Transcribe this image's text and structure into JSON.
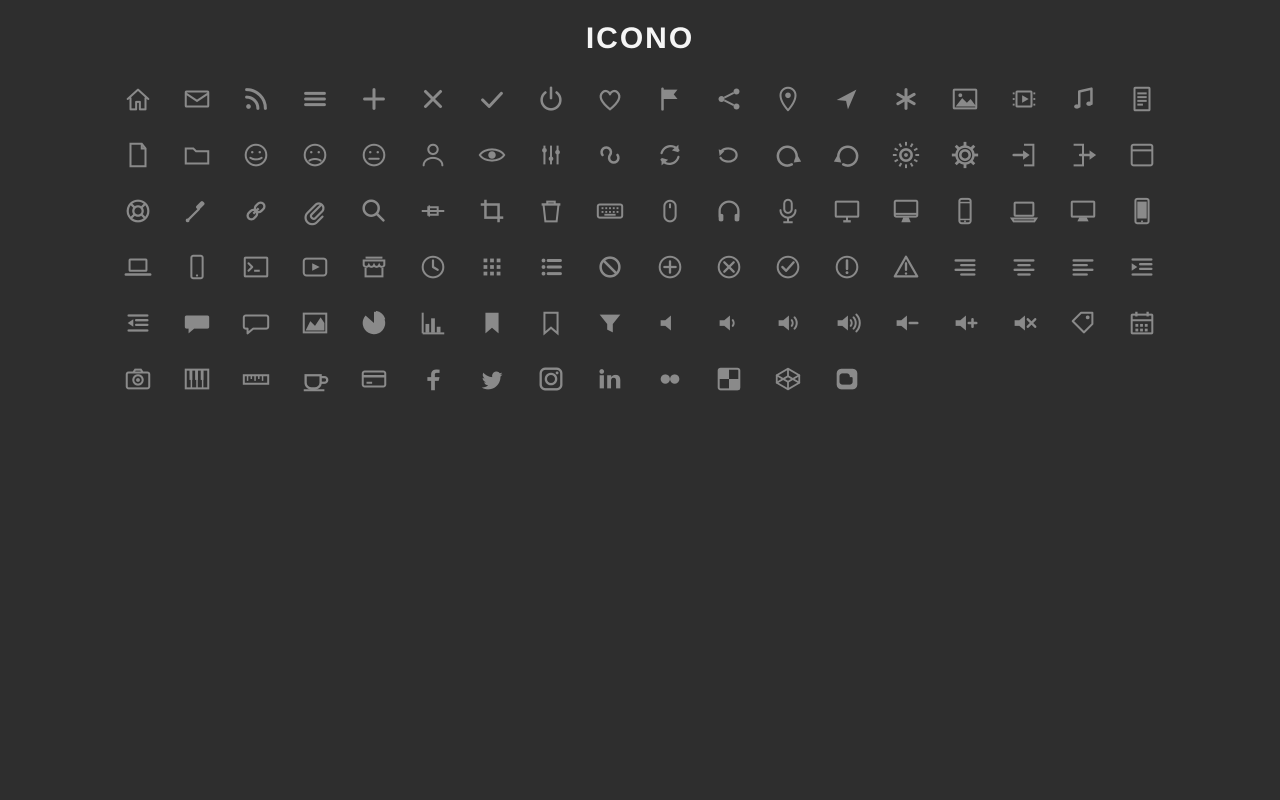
{
  "title": "ICONO",
  "colors": {
    "bg": "#2e2e2e",
    "icon": "#8a8a8a",
    "title": "#f5f5f5"
  },
  "icons": [
    "home",
    "mail",
    "rss",
    "hamburger",
    "plus",
    "cross",
    "check",
    "power",
    "heart",
    "flag",
    "share",
    "location-pin",
    "location-arrow",
    "asterisk",
    "image",
    "video",
    "music",
    "document",
    "file",
    "folder",
    "smile",
    "frown",
    "meh",
    "user",
    "eye",
    "sliders",
    "infinity",
    "sync",
    "loop",
    "undo",
    "redo",
    "sun",
    "gear",
    "sign-in",
    "sign-out",
    "browser",
    "life-ring",
    "dropper",
    "chain",
    "paperclip",
    "search",
    "text-align",
    "crop",
    "trash",
    "keyboard",
    "mouse",
    "headphones",
    "microphone",
    "display",
    "imac",
    "iphone",
    "macbook",
    "display-alt",
    "phone-device",
    "laptop",
    "phone-outline",
    "terminal",
    "youtube",
    "market",
    "clock",
    "tiles",
    "list",
    "forbidden",
    "plus-circle",
    "cross-circle",
    "check-circle",
    "exclamation-circle",
    "caution",
    "align-right",
    "align-center",
    "align-left",
    "indent",
    "outdent",
    "chat-filled",
    "chat-outline",
    "area-chart",
    "pie-chart",
    "bar-chart",
    "bookmark",
    "bookmark-empty",
    "filter",
    "volume-off",
    "volume-low",
    "volume-medium",
    "volume-high",
    "volume-decrease",
    "volume-increase",
    "volume-mute",
    "tag",
    "calendar",
    "camera",
    "piano",
    "ruler",
    "cup",
    "creditcard",
    "facebook",
    "twitter",
    "instagram",
    "linkedin",
    "flickr",
    "delicious",
    "codepen",
    "blogger"
  ]
}
